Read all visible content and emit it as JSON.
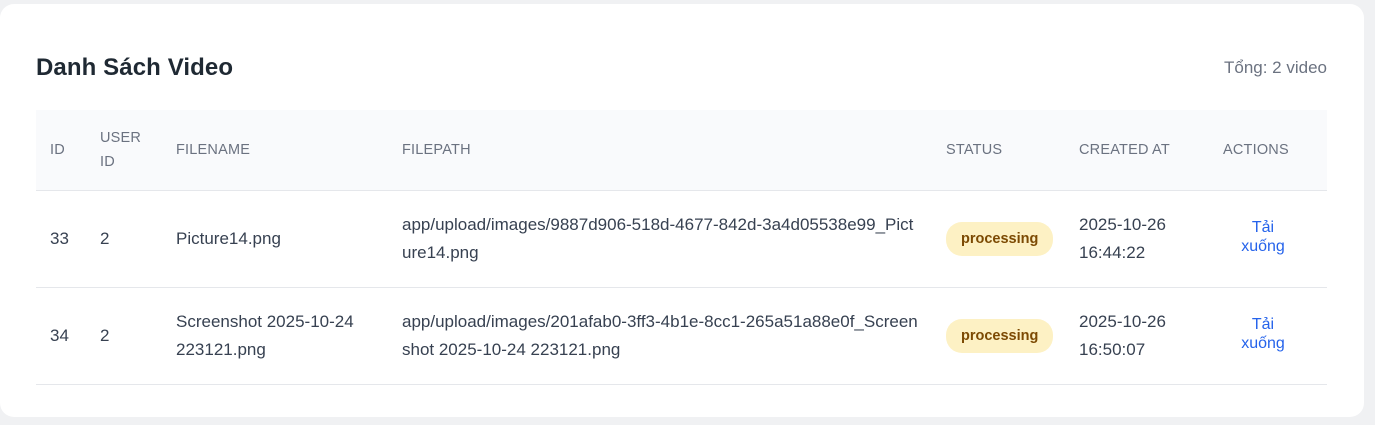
{
  "header": {
    "title": "Danh Sách Video",
    "total": "Tổng: 2 video"
  },
  "table": {
    "columns": [
      "ID",
      "USER ID",
      "FILENAME",
      "FILEPATH",
      "STATUS",
      "CREATED AT",
      "ACTIONS"
    ],
    "rows": [
      {
        "id": "33",
        "user_id": "2",
        "filename": "Picture14.png",
        "filepath": "app/upload/images/9887d906-518d-4677-842d-3a4d05538e99_Picture14.png",
        "status": "processing",
        "created_at": "2025-10-26 16:44:22",
        "action": "Tải xuống"
      },
      {
        "id": "34",
        "user_id": "2",
        "filename": "Screenshot 2025-10-24 223121.png",
        "filepath": "app/upload/images/201afab0-3ff3-4b1e-8cc1-265a51a88e0f_Screenshot 2025-10-24 223121.png",
        "status": "processing",
        "created_at": "2025-10-26 16:50:07",
        "action": "Tải xuống"
      }
    ]
  },
  "colors": {
    "status_processing_bg": "#fdf1c4",
    "status_processing_text": "#7c4a03",
    "link": "#2563eb"
  }
}
